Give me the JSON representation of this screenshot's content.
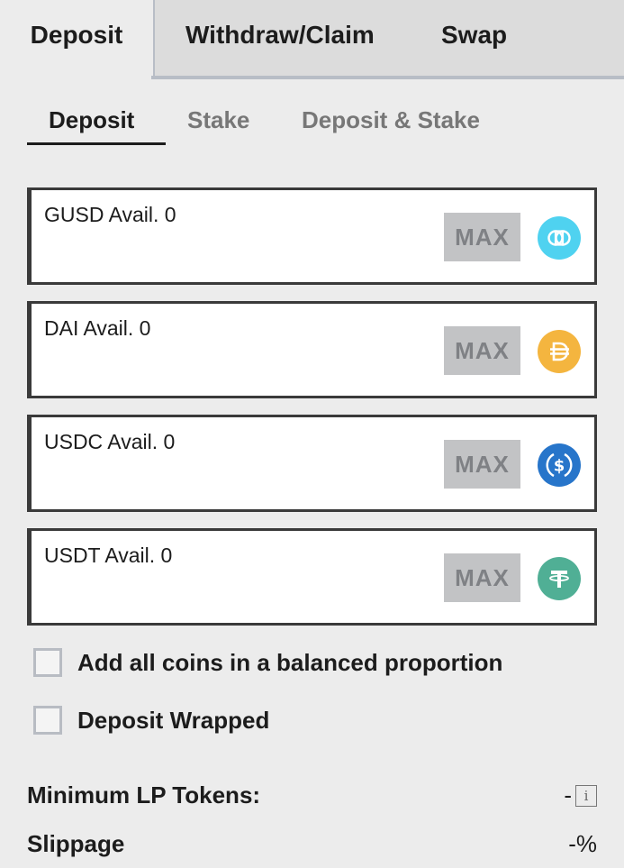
{
  "tabs": {
    "deposit": "Deposit",
    "withdraw": "Withdraw/Claim",
    "swap": "Swap"
  },
  "subtabs": {
    "deposit": "Deposit",
    "stake": "Stake",
    "deposit_stake": "Deposit & Stake"
  },
  "coins": [
    {
      "label": "GUSD Avail. 0",
      "max": "MAX",
      "icon": "gusd-icon",
      "color": "#4fd2f0"
    },
    {
      "label": "DAI Avail. 0",
      "max": "MAX",
      "icon": "dai-icon",
      "color": "#f4b53f"
    },
    {
      "label": "USDC Avail. 0",
      "max": "MAX",
      "icon": "usdc-icon",
      "color": "#2775ca"
    },
    {
      "label": "USDT Avail. 0",
      "max": "MAX",
      "icon": "usdt-icon",
      "color": "#50af95"
    }
  ],
  "options": {
    "balanced": "Add all coins in a balanced proportion",
    "wrapped": "Deposit Wrapped"
  },
  "info": {
    "min_lp_label": "Minimum LP Tokens:",
    "min_lp_value": "-",
    "info_icon": "i",
    "slippage_label": "Slippage",
    "slippage_value": "-%"
  }
}
